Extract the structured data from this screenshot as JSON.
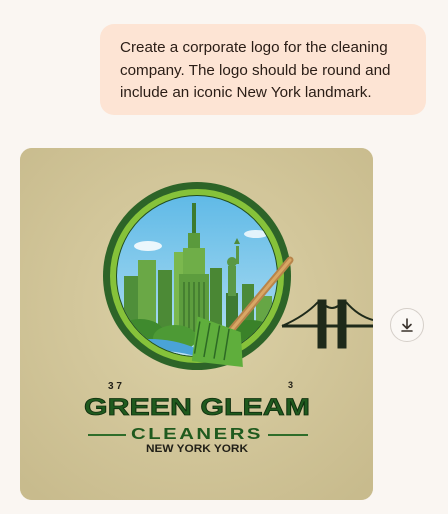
{
  "message": {
    "text": "Create a corporate logo for the cleaning company. The logo should be round and include an iconic New York landmark."
  },
  "generated_image": {
    "artifact_left": "3 7",
    "artifact_right": "3",
    "line1": "GREEN GLEAM",
    "line2": "CLEANERS",
    "line3": "NEW YORK YORK",
    "colors": {
      "background": "#d3c79c",
      "ring": "#2f6d2a",
      "ring_inner": "#8cc63f",
      "sky": "#7fc8ea",
      "text_green": "#1f5a1e",
      "text_dark": "#222018"
    }
  },
  "actions": {
    "download_icon": "download-icon"
  }
}
